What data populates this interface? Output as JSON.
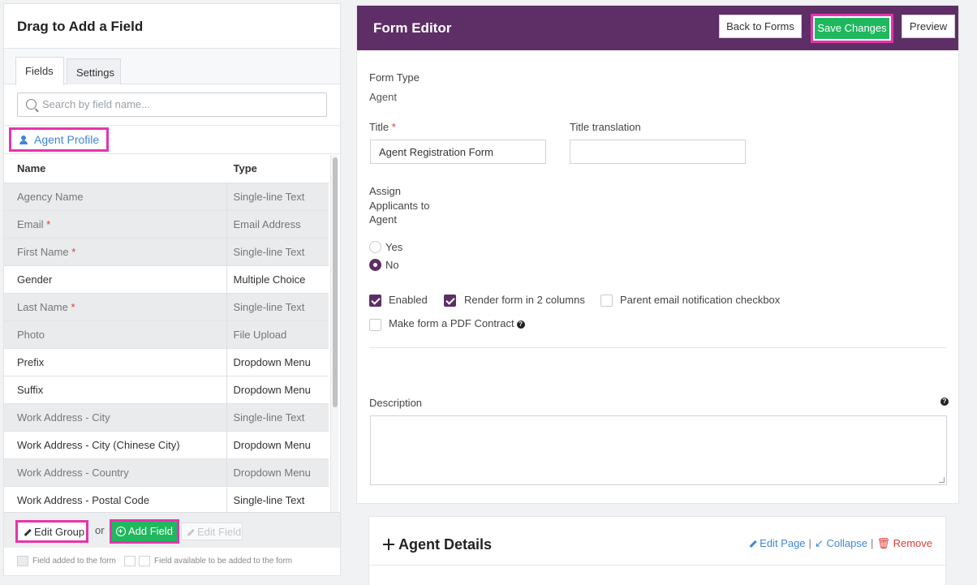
{
  "left_panel": {
    "title": "Drag to Add a Field",
    "tabs": [
      "Fields",
      "Settings"
    ],
    "search_placeholder": "Search by field name...",
    "group_name": "Agent Profile",
    "columns": [
      "Name",
      "Type"
    ],
    "rows": [
      {
        "name": "Agency Name",
        "required": "",
        "type": "Single-line Text",
        "added": true
      },
      {
        "name": "Email",
        "required": "*",
        "type": "Email Address",
        "added": true
      },
      {
        "name": "First Name",
        "required": "*",
        "type": "Single-line Text",
        "added": true
      },
      {
        "name": "Gender",
        "required": "",
        "type": "Multiple Choice",
        "added": false
      },
      {
        "name": "Last Name",
        "required": "*",
        "type": "Single-line Text",
        "added": true
      },
      {
        "name": "Photo",
        "required": "",
        "type": "File Upload",
        "added": true
      },
      {
        "name": "Prefix",
        "required": "",
        "type": "Dropdown Menu",
        "added": false
      },
      {
        "name": "Suffix",
        "required": "",
        "type": "Dropdown Menu",
        "added": false
      },
      {
        "name": "Work Address - City",
        "required": "",
        "type": "Single-line Text",
        "added": true
      },
      {
        "name": "Work Address - City (Chinese City)",
        "required": "",
        "type": "Dropdown Menu",
        "added": false
      },
      {
        "name": "Work Address - Country",
        "required": "",
        "type": "Dropdown Menu",
        "added": true
      },
      {
        "name": "Work Address - Postal Code",
        "required": "",
        "type": "Single-line Text",
        "added": false
      }
    ],
    "footer": {
      "edit_group": "Edit Group",
      "or": "or",
      "add_field": "Add Field",
      "edit_field": "Edit Field"
    },
    "legend": {
      "added": "Field added to the form",
      "available": "Field available to be added to the form"
    }
  },
  "editor": {
    "title": "Form Editor",
    "buttons": {
      "back": "Back to Forms",
      "save": "Save Changes",
      "preview": "Preview"
    },
    "form_type_label": "Form Type",
    "form_type_value": "Agent",
    "title_label": "Title",
    "title_required": "*",
    "title_value": "Agent Registration Form",
    "title_translation_label": "Title translation",
    "title_translation_value": "",
    "assign_label_1": "Assign",
    "assign_label_2": "Applicants to",
    "assign_label_3": "Agent",
    "radio_yes": "Yes",
    "radio_no": "No",
    "radio_selected": "No",
    "checkboxes": {
      "enabled": {
        "label": "Enabled",
        "checked": true
      },
      "two_columns": {
        "label": "Render form in 2 columns",
        "checked": true
      },
      "parent_email": {
        "label": "Parent email notification checkbox",
        "checked": false
      },
      "pdf_contract": {
        "label": "Make form a PDF Contract",
        "checked": false
      }
    },
    "description_label": "Description",
    "description_value": ""
  },
  "section": {
    "title": "Agent Details",
    "edit_page": "Edit Page",
    "collapse": "Collapse",
    "remove": "Remove",
    "separator": "|"
  },
  "colors": {
    "header_purple": "#5e2f66",
    "highlight_pink": "#e535ab",
    "green": "#1fb85f",
    "link_blue": "#3f86d7",
    "required_red": "#d9403a"
  }
}
